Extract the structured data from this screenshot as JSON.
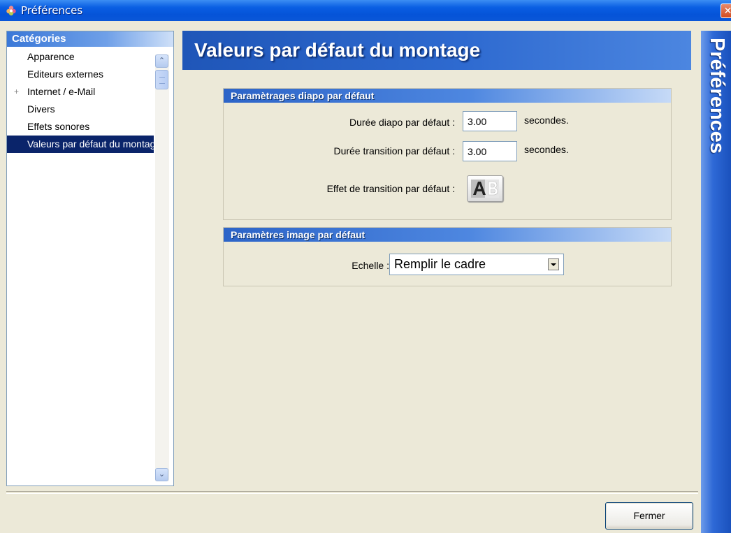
{
  "window": {
    "title": "Préférences",
    "close_glyph": "✕"
  },
  "categories": {
    "header": "Catégories",
    "items": [
      {
        "label": "Apparence",
        "expandable": false
      },
      {
        "label": "Editeurs externes",
        "expandable": false
      },
      {
        "label": "Internet / e-Mail",
        "expandable": true,
        "expander_glyph": "+"
      },
      {
        "label": "Divers",
        "expandable": false
      },
      {
        "label": "Effets sonores",
        "expandable": false
      },
      {
        "label": "Valeurs par défaut du montage",
        "expandable": false,
        "selected": true
      }
    ],
    "scroll_up_glyph": "⌃",
    "scroll_down_glyph": "⌄"
  },
  "main": {
    "heading": "Valeurs par défaut du montage",
    "slide_group": {
      "title": "Paramètrages diapo par défaut",
      "slide_duration_label": "Durée diapo par défaut :",
      "slide_duration_value": "3.00",
      "transition_duration_label": "Durée transition par défaut :",
      "transition_duration_value": "3.00",
      "unit_label": "secondes.",
      "transition_effect_label": "Effet de transition par défaut :",
      "transition_effect_icon": "ab-transition-icon"
    },
    "image_group": {
      "title": "Paramètres image par défaut",
      "scale_label": "Echelle :",
      "scale_value": "Remplir le cadre"
    }
  },
  "footer": {
    "close_label": "Fermer"
  },
  "side_banner": {
    "text": "Préférences"
  },
  "colors": {
    "titlebar": "#0553d8",
    "selection": "#0a246a",
    "heading_blue": "#2e6ad0",
    "window_bg": "#ece9d8"
  }
}
